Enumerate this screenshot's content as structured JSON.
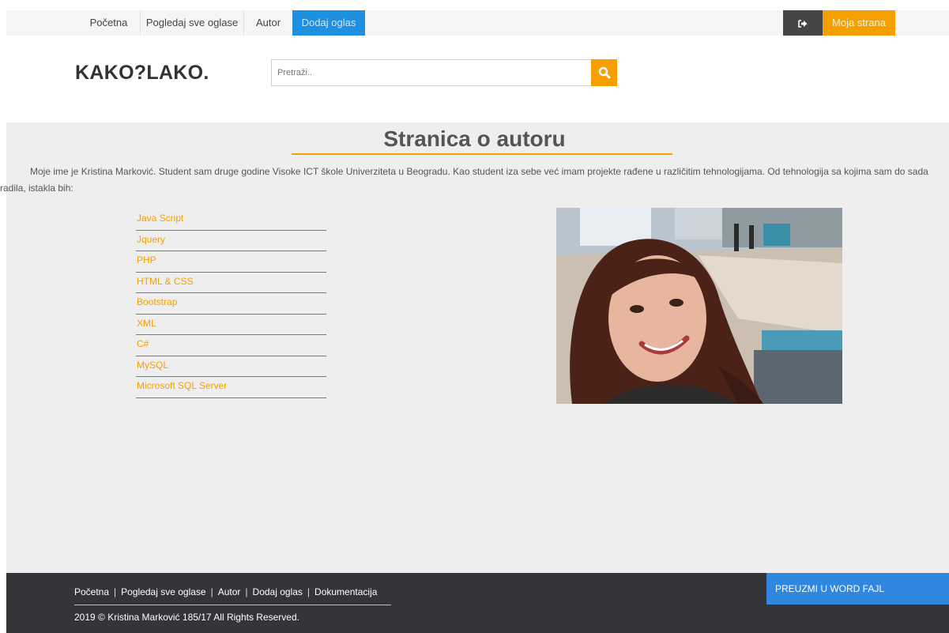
{
  "topnav": {
    "items": [
      {
        "label": "Početna"
      },
      {
        "label": "Pogledaj sve oglase"
      },
      {
        "label": "Autor"
      },
      {
        "label": "Dodaj oglas"
      }
    ],
    "logout_icon": "sign-out-icon",
    "my_page_label": "Moja strana"
  },
  "header": {
    "logo": "KAKO?LAKO.",
    "search_placeholder": "Pretraži..",
    "search_icon": "search-icon"
  },
  "main": {
    "title": "Stranica o autoru",
    "intro": "Moje ime je Kristina Marković. Student sam druge godine Visoke ICT škole Univerziteta u Beogradu. Kao student iza sebe već imam projekte rađene u različitim tehnologijama. Od tehnologija sa kojima sam do sada radila, istakla bih:",
    "technologies": [
      "Java Script",
      "Jquery",
      "PHP",
      "HTML & CSS",
      "Bootstrap",
      "XML",
      "C#",
      "MySQL",
      "Microsoft SQL Server"
    ]
  },
  "footer": {
    "links": [
      "Početna",
      "Pogledaj sve oglase",
      "Autor",
      "Dodaj oglas",
      "Dokumentacija"
    ],
    "separator": "|",
    "copyright": "2019 © Kristina Marković 185/17 All Rights Reserved.",
    "download_label": "PREUZMI U WORD FAJL"
  },
  "colors": {
    "accent": "#f5a000",
    "active_nav": "#1f8fe0",
    "footer_bg": "#333538",
    "download_bg": "#2f87e0"
  }
}
